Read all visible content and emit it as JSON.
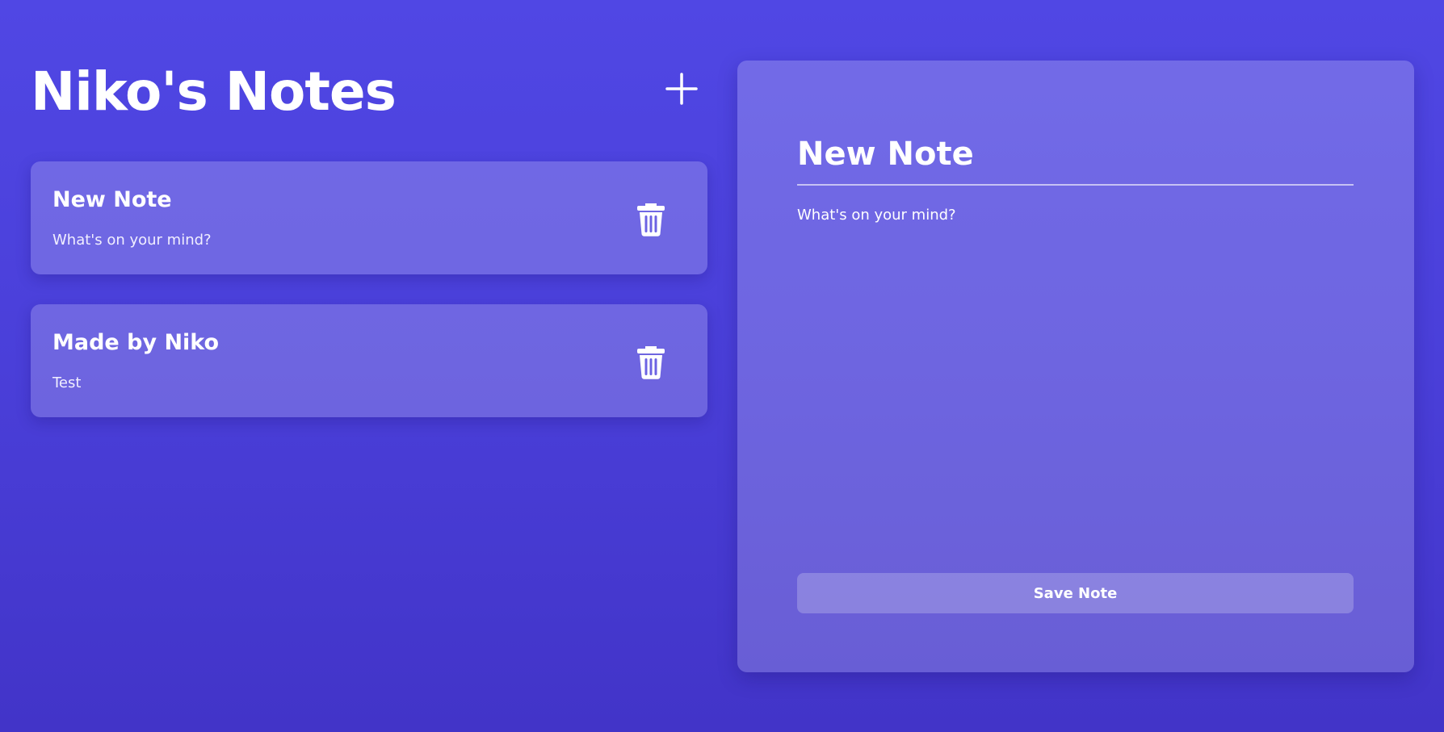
{
  "app": {
    "title": "Niko's Notes",
    "add_icon": "plus-icon"
  },
  "notes": [
    {
      "title": "New Note",
      "body": "What's on your mind?",
      "delete_icon": "trash-icon"
    },
    {
      "title": "Made by Niko",
      "body": "Test",
      "delete_icon": "trash-icon"
    }
  ],
  "editor": {
    "title_value": "New Note",
    "body_placeholder": "What's on your mind?",
    "save_label": "Save Note"
  },
  "colors": {
    "background_top": "#5047e4",
    "background_bottom": "#4234c8",
    "text": "#ffffff"
  }
}
